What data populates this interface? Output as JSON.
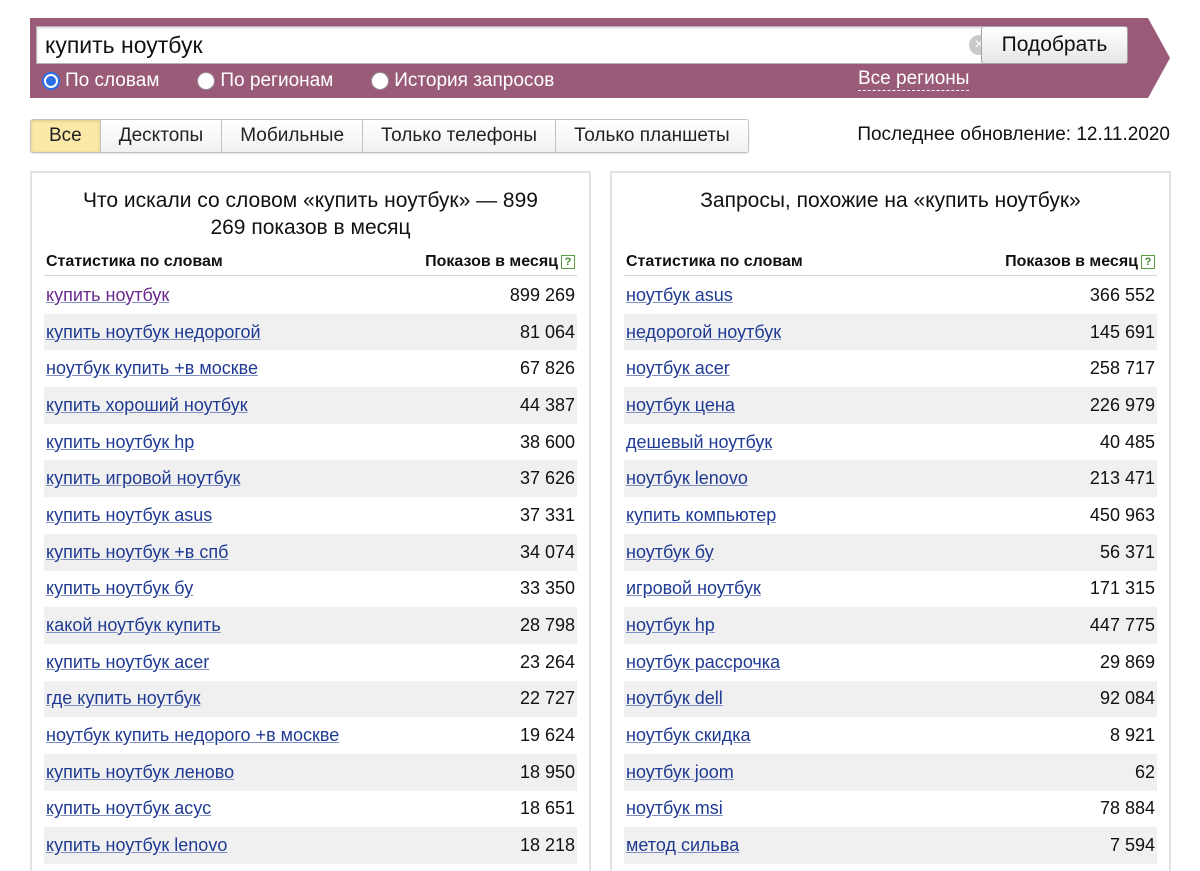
{
  "search": {
    "query": "купить ноутбук",
    "submit_label": "Подобрать",
    "modes": [
      {
        "label": "По словам",
        "selected": true
      },
      {
        "label": "По регионам",
        "selected": false
      },
      {
        "label": "История запросов",
        "selected": false
      }
    ],
    "regions_label": "Все регионы"
  },
  "device_tabs": [
    {
      "label": "Все",
      "active": true
    },
    {
      "label": "Десктопы",
      "active": false
    },
    {
      "label": "Мобильные",
      "active": false
    },
    {
      "label": "Только телефоны",
      "active": false
    },
    {
      "label": "Только планшеты",
      "active": false
    }
  ],
  "last_update": "Последнее обновление: 12.11.2020",
  "left_panel": {
    "title": "Что искали со словом «купить ноутбук» — 899 269 показов в месяц",
    "col_keyword": "Статистика по словам",
    "col_count": "Показов в месяц",
    "rows": [
      {
        "keyword": "купить ноутбук",
        "count": "899 269",
        "visited": true
      },
      {
        "keyword": "купить ноутбук недорогой",
        "count": "81 064"
      },
      {
        "keyword": "ноутбук купить +в москве",
        "count": "67 826"
      },
      {
        "keyword": "купить хороший ноутбук",
        "count": "44 387"
      },
      {
        "keyword": "купить ноутбук hp",
        "count": "38 600"
      },
      {
        "keyword": "купить игровой ноутбук",
        "count": "37 626"
      },
      {
        "keyword": "купить ноутбук asus",
        "count": "37 331"
      },
      {
        "keyword": "купить ноутбук +в спб",
        "count": "34 074"
      },
      {
        "keyword": "купить ноутбук бу",
        "count": "33 350"
      },
      {
        "keyword": "какой ноутбук купить",
        "count": "28 798"
      },
      {
        "keyword": "купить ноутбук acer",
        "count": "23 264"
      },
      {
        "keyword": "где купить ноутбук",
        "count": "22 727"
      },
      {
        "keyword": "ноутбук купить недорого +в москве",
        "count": "19 624"
      },
      {
        "keyword": "купить ноутбук леново",
        "count": "18 950"
      },
      {
        "keyword": "купить ноутбук асус",
        "count": "18 651"
      },
      {
        "keyword": "купить ноутбук lenovo",
        "count": "18 218"
      }
    ]
  },
  "right_panel": {
    "title": "Запросы, похожие на «купить ноутбук»",
    "col_keyword": "Статистика по словам",
    "col_count": "Показов в месяц",
    "rows": [
      {
        "keyword": "ноутбук asus",
        "count": "366 552"
      },
      {
        "keyword": "недорогой ноутбук",
        "count": "145 691"
      },
      {
        "keyword": "ноутбук acer",
        "count": "258 717"
      },
      {
        "keyword": "ноутбук цена",
        "count": "226 979"
      },
      {
        "keyword": "дешевый ноутбук",
        "count": "40 485"
      },
      {
        "keyword": "ноутбук lenovo",
        "count": "213 471"
      },
      {
        "keyword": "купить компьютер",
        "count": "450 963"
      },
      {
        "keyword": "ноутбук бу",
        "count": "56 371"
      },
      {
        "keyword": "игровой ноутбук",
        "count": "171 315"
      },
      {
        "keyword": "ноутбук hp",
        "count": "447 775"
      },
      {
        "keyword": "ноутбук рассрочка",
        "count": "29 869"
      },
      {
        "keyword": "ноутбук dell",
        "count": "92 084"
      },
      {
        "keyword": "ноутбук скидка",
        "count": "8 921"
      },
      {
        "keyword": "ноутбук joom",
        "count": "62"
      },
      {
        "keyword": "ноутбук msi",
        "count": "78 884"
      },
      {
        "keyword": "метод сильва",
        "count": "7 594"
      }
    ]
  },
  "colors": {
    "search_bar": "#9a5b79",
    "link": "#1f3a93",
    "visited_link": "#6a2a8e",
    "active_tab": "#fbe9a8",
    "zebra_row": "#f0f0f0"
  },
  "icons": {
    "clear": "clear-icon",
    "help": "help-icon"
  }
}
